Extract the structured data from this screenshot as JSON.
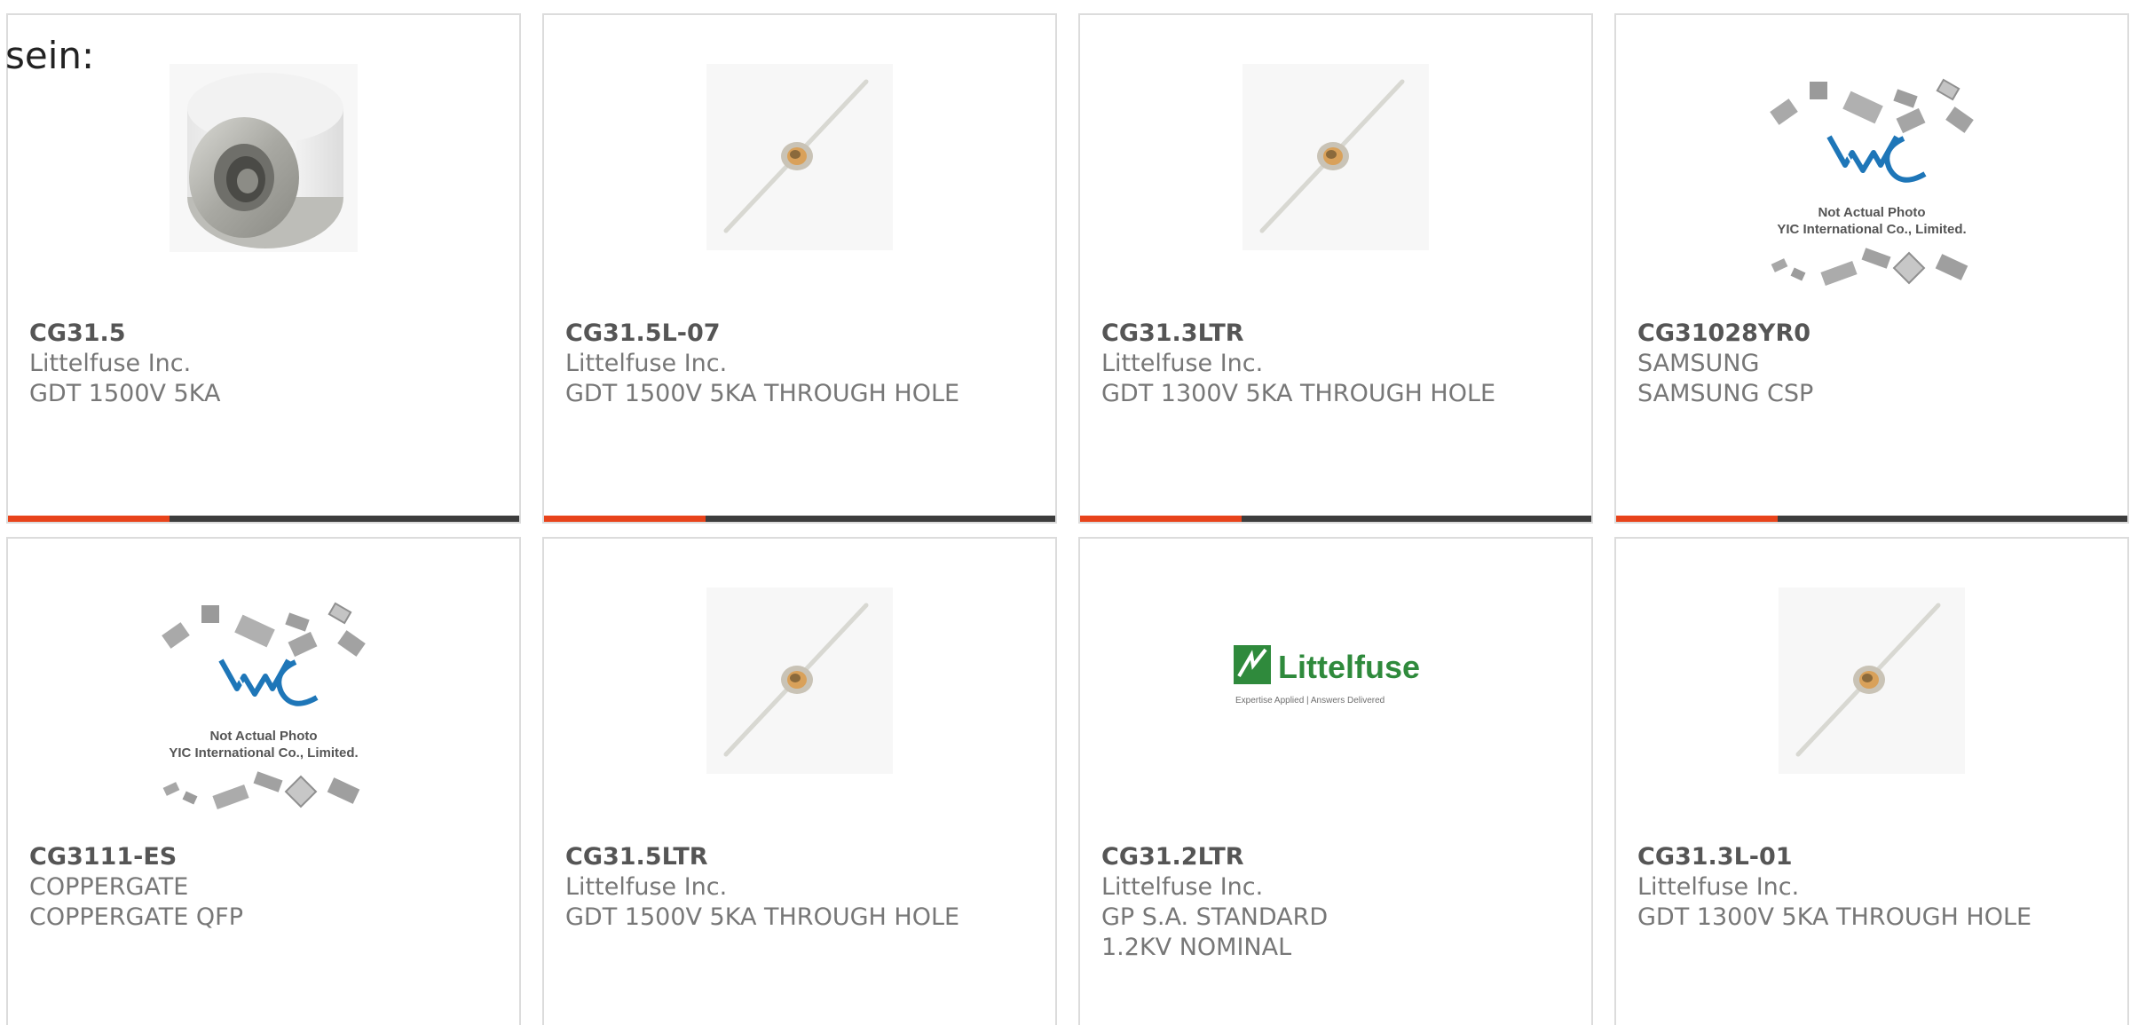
{
  "intro_text": "sein:",
  "colors": {
    "accent": "#e8431b",
    "bar": "#3d3d3d",
    "border": "#dcdcdc",
    "part_text": "#555555",
    "meta_text": "#777777"
  },
  "cards": [
    {
      "part": "CG31.5",
      "manufacturer": "Littelfuse Inc.",
      "description": "GDT 1500V 5KA",
      "image": "gdt-disc-component"
    },
    {
      "part": "CG31.5L-07",
      "manufacturer": "Littelfuse Inc.",
      "description": "GDT 1500V 5KA THROUGH HOLE",
      "image": "gdt-leaded-component"
    },
    {
      "part": "CG31.3LTR",
      "manufacturer": "Littelfuse Inc.",
      "description": "GDT 1300V 5KA THROUGH HOLE",
      "image": "gdt-leaded-component"
    },
    {
      "part": "CG31028YR0",
      "manufacturer": "SAMSUNG",
      "description": "SAMSUNG CSP",
      "image": "yic-placeholder"
    },
    {
      "part": "CG3111-ES",
      "manufacturer": "COPPERGATE",
      "description": "COPPERGATE QFP",
      "image": "yic-placeholder"
    },
    {
      "part": "CG31.5LTR",
      "manufacturer": "Littelfuse Inc.",
      "description": "GDT 1500V 5KA THROUGH HOLE",
      "image": "gdt-leaded-component"
    },
    {
      "part": "CG31.2LTR",
      "manufacturer": "Littelfuse Inc.",
      "description": "GP S.A. STANDARD 1.2KV NOMINAL",
      "image": "littelfuse-logo"
    },
    {
      "part": "CG31.3L-01",
      "manufacturer": "Littelfuse Inc.",
      "description": "GDT 1300V 5KA THROUGH HOLE",
      "image": "gdt-leaded-component"
    }
  ],
  "yic_placeholder": {
    "line1": "Not Actual Photo",
    "line2": "YIC International Co., Limited."
  },
  "littelfuse_logo": {
    "brand": "Littelfuse",
    "tagline": "Expertise Applied | Answers Delivered"
  }
}
